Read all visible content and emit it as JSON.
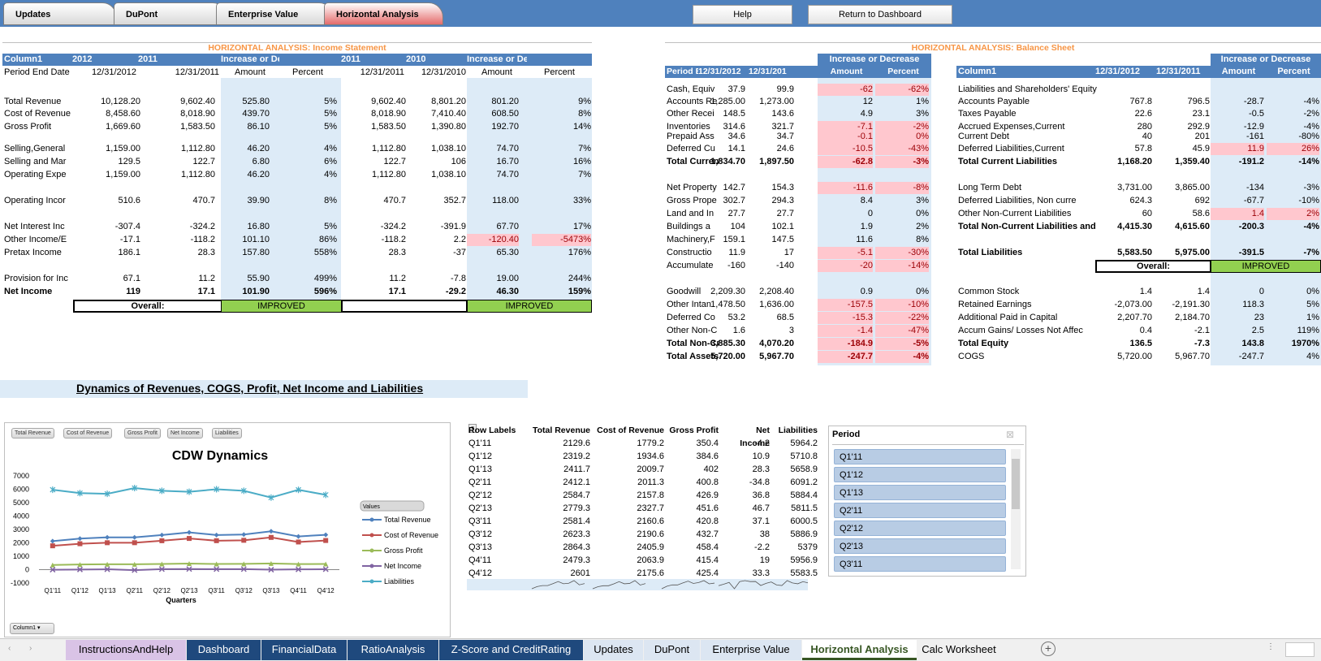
{
  "nav": {
    "tabs": [
      "Updates",
      "DuPont",
      "Enterprise Value",
      "Horizontal Analysis"
    ],
    "help": "Help",
    "return": "Return to Dashboard"
  },
  "is": {
    "title": "HORIZONTAL ANALYSIS: Income Statement",
    "headers": [
      "Column1",
      "2012",
      "2011",
      "Increase or Decrease",
      "",
      "2011",
      "2010",
      "Increase or Decrease",
      ""
    ],
    "sub": [
      "Period End Date",
      "12/31/2012",
      "12/31/2011",
      "Amount",
      "Percent",
      "12/31/2011",
      "12/31/2010",
      "Amount",
      "Percent"
    ],
    "rows": [
      {
        "top": 118,
        "label": "Total Revenue",
        "v": [
          "10,128.20",
          "9,602.40",
          "525.80",
          "5%",
          "9,602.40",
          "8,801.20",
          "801.20",
          "9%"
        ]
      },
      {
        "top": 133,
        "label": "Cost of Revenue",
        "v": [
          "8,458.60",
          "8,018.90",
          "439.70",
          "5%",
          "8,018.90",
          "7,410.40",
          "608.50",
          "8%"
        ]
      },
      {
        "top": 149,
        "label": "Gross Profit",
        "v": [
          "1,669.60",
          "1,583.50",
          "86.10",
          "5%",
          "1,583.50",
          "1,390.80",
          "192.70",
          "14%"
        ]
      },
      {
        "top": 176,
        "label": "Selling,General",
        "v": [
          "1,159.00",
          "1,112.80",
          "46.20",
          "4%",
          "1,112.80",
          "1,038.10",
          "74.70",
          "7%"
        ]
      },
      {
        "top": 192,
        "label": "Selling and Mar",
        "v": [
          "129.5",
          "122.7",
          "6.80",
          "6%",
          "122.7",
          "106",
          "16.70",
          "16%"
        ]
      },
      {
        "top": 208,
        "label": "Operating Expe",
        "v": [
          "1,159.00",
          "1,112.80",
          "46.20",
          "4%",
          "1,112.80",
          "1,038.10",
          "74.70",
          "7%"
        ]
      },
      {
        "top": 240,
        "label": "Operating Incor",
        "v": [
          "510.6",
          "470.7",
          "39.90",
          "8%",
          "470.7",
          "352.7",
          "118.00",
          "33%"
        ]
      },
      {
        "top": 272,
        "label": "Net Interest Inc",
        "v": [
          "-307.4",
          "-324.2",
          "16.80",
          "5%",
          "-324.2",
          "-391.9",
          "67.70",
          "17%"
        ]
      },
      {
        "top": 288,
        "label": "Other Income/E",
        "v": [
          "-17.1",
          "-118.2",
          "101.10",
          "86%",
          "-118.2",
          "2.2",
          "-120.40",
          "-5473%"
        ],
        "negR": true
      },
      {
        "top": 304,
        "label": "Pretax Income",
        "v": [
          "186.1",
          "28.3",
          "157.80",
          "558%",
          "28.3",
          "-37",
          "65.30",
          "176%"
        ]
      },
      {
        "top": 336,
        "label": "Provision for Inc",
        "v": [
          "67.1",
          "11.2",
          "55.90",
          "499%",
          "11.2",
          "-7.8",
          "19.00",
          "244%"
        ]
      },
      {
        "top": 352,
        "label": "Net Income",
        "v": [
          "119",
          "17.1",
          "101.90",
          "596%",
          "17.1",
          "-29.2",
          "46.30",
          "159%"
        ],
        "bold": true
      }
    ],
    "overall": "Overall:",
    "improved1": "IMPROVED",
    "improved2": "IMPROVED"
  },
  "bs": {
    "title": "HORIZONTAL ANALYSIS: Balance Sheet",
    "incdec": "Increase or Decrease",
    "left_headers": [
      "Period End D",
      "12/31/2012",
      "12/31/201",
      "Amount",
      "Percent"
    ],
    "left": [
      {
        "top": 103,
        "label": "Cash, Equiv",
        "v": [
          "37.9",
          "99.9",
          "-62",
          "-62%"
        ],
        "neg": true
      },
      {
        "top": 118,
        "label": "Accounts Re",
        "v": [
          "1,285.00",
          "1,273.00",
          "12",
          "1%"
        ]
      },
      {
        "top": 133,
        "label": "Other Recei",
        "v": [
          "148.5",
          "143.6",
          "4.9",
          "3%"
        ]
      },
      {
        "top": 149,
        "label": "Inventories",
        "v": [
          "314.6",
          "321.7",
          "-7.1",
          "-2%"
        ],
        "neg": true
      },
      {
        "top": 161,
        "label": "Prepaid Ass",
        "v": [
          "34.6",
          "34.7",
          "-0.1",
          "0%"
        ],
        "neg": true
      },
      {
        "top": 176,
        "label": "Deferred Cu",
        "v": [
          "14.1",
          "24.6",
          "-10.5",
          "-43%"
        ],
        "neg": true
      },
      {
        "top": 192,
        "label": "Total Current",
        "v": [
          "1,834.70",
          "1,897.50",
          "-62.8",
          "-3%"
        ],
        "neg": true,
        "bold": true
      },
      {
        "top": 224,
        "label": "Net Property",
        "v": [
          "142.7",
          "154.3",
          "-11.6",
          "-8%"
        ],
        "neg": true
      },
      {
        "top": 240,
        "label": "Gross Prope",
        "v": [
          "302.7",
          "294.3",
          "8.4",
          "3%"
        ]
      },
      {
        "top": 256,
        "label": "Land and In",
        "v": [
          "27.7",
          "27.7",
          "0",
          "0%"
        ]
      },
      {
        "top": 272,
        "label": "Buildings a",
        "v": [
          "104",
          "102.1",
          "1.9",
          "2%"
        ]
      },
      {
        "top": 288,
        "label": "Machinery,F",
        "v": [
          "159.1",
          "147.5",
          "11.6",
          "8%"
        ]
      },
      {
        "top": 304,
        "label": "Constructio",
        "v": [
          "11.9",
          "17",
          "-5.1",
          "-30%"
        ],
        "neg": true
      },
      {
        "top": 320,
        "label": "Accumulate",
        "v": [
          "-160",
          "-140",
          "-20",
          "-14%"
        ],
        "neg": true
      },
      {
        "top": 352,
        "label": "Goodwill",
        "v": [
          "2,209.30",
          "2,208.40",
          "0.9",
          "0%"
        ]
      },
      {
        "top": 368,
        "label": "Other Intan",
        "v": [
          "1,478.50",
          "1,636.00",
          "-157.5",
          "-10%"
        ],
        "neg": true
      },
      {
        "top": 384,
        "label": "Deferred Co",
        "v": [
          "53.2",
          "68.5",
          "-15.3",
          "-22%"
        ],
        "neg": true
      },
      {
        "top": 400,
        "label": "Other Non-C",
        "v": [
          "1.6",
          "3",
          "-1.4",
          "-47%"
        ],
        "neg": true
      },
      {
        "top": 416,
        "label": "Total Non-Cu",
        "v": [
          "3,885.30",
          "4,070.20",
          "-184.9",
          "-5%"
        ],
        "neg": true,
        "bold": true
      },
      {
        "top": 432,
        "label": "Total Assets",
        "v": [
          "5,720.00",
          "5,967.70",
          "-247.7",
          "-4%"
        ],
        "neg": true,
        "bold": true
      }
    ],
    "right_headers": [
      "Column1",
      "12/31/2012",
      "12/31/2011",
      "Amount",
      "Percent"
    ],
    "right_sub": "Liabilities and Shareholders' Equity",
    "right": [
      {
        "top": 118,
        "label": "Accounts Payable",
        "v": [
          "767.8",
          "796.5",
          "-28.7",
          "-4%"
        ]
      },
      {
        "top": 133,
        "label": "Taxes Payable",
        "v": [
          "22.6",
          "23.1",
          "-0.5",
          "-2%"
        ]
      },
      {
        "top": 149,
        "label": "Accrued Expenses,Current",
        "v": [
          "280",
          "292.9",
          "-12.9",
          "-4%"
        ]
      },
      {
        "top": 161,
        "label": "Current Debt",
        "v": [
          "40",
          "201",
          "-161",
          "-80%"
        ]
      },
      {
        "top": 176,
        "label": "Deferred Liabilities,Current",
        "v": [
          "57.8",
          "45.9",
          "11.9",
          "26%"
        ],
        "neg": true
      },
      {
        "top": 192,
        "label": "Total Current Liabilities",
        "v": [
          "1,168.20",
          "1,359.40",
          "-191.2",
          "-14%"
        ],
        "bold": true
      },
      {
        "top": 224,
        "label": "Long Term Debt",
        "v": [
          "3,731.00",
          "3,865.00",
          "-134",
          "-3%"
        ]
      },
      {
        "top": 240,
        "label": "Deferred Liabilities, Non curre",
        "v": [
          "624.3",
          "692",
          "-67.7",
          "-10%"
        ]
      },
      {
        "top": 256,
        "label": "Other Non-Current Liabilities",
        "v": [
          "60",
          "58.6",
          "1.4",
          "2%"
        ],
        "neg": true
      },
      {
        "top": 272,
        "label": "Total Non-Current Liabilities and M",
        "v": [
          "4,415.30",
          "4,615.60",
          "-200.3",
          "-4%"
        ],
        "bold": true
      },
      {
        "top": 304,
        "label": "Total Liabilities",
        "v": [
          "5,583.50",
          "5,975.00",
          "-391.5",
          "-7%"
        ],
        "bold": true
      },
      {
        "top": 352,
        "label": "Common Stock",
        "v": [
          "1.4",
          "1.4",
          "0",
          "0%"
        ]
      },
      {
        "top": 368,
        "label": "Retained Earnings",
        "v": [
          "-2,073.00",
          "-2,191.30",
          "118.3",
          "5%"
        ]
      },
      {
        "top": 384,
        "label": "Additional Paid in Capital",
        "v": [
          "2,207.70",
          "2,184.70",
          "23",
          "1%"
        ]
      },
      {
        "top": 400,
        "label": "Accum Gains/ Losses Not Affec",
        "v": [
          "0.4",
          "-2.1",
          "2.5",
          "119%"
        ]
      },
      {
        "top": 416,
        "label": "Total Equity",
        "v": [
          "136.5",
          "-7.3",
          "143.8",
          "1970%"
        ],
        "bold": true
      },
      {
        "top": 432,
        "label": "COGS",
        "v": [
          "5,720.00",
          "5,967.70",
          "-247.7",
          "4%"
        ]
      }
    ],
    "overall": "Overall:",
    "improved": "IMPROVED"
  },
  "dyn_title": "Dynamics of Revenues, COGS, Profit, Net Income and Liabilities",
  "chart_filters": [
    "Total Revenue",
    "Cost of Revenue",
    "Gross Profit",
    "Net Income",
    "Liabilities"
  ],
  "chart_data": {
    "type": "line",
    "title": "CDW Dynamics",
    "xlabel": "Quarters",
    "ylabel": "",
    "categories": [
      "Q1'11",
      "Q1'12",
      "Q1'13",
      "Q2'11",
      "Q2'12",
      "Q2'13",
      "Q3'11",
      "Q3'12",
      "Q3'13",
      "Q4'11",
      "Q4'12"
    ],
    "ylim": [
      -1000,
      7000
    ],
    "yticks": [
      7000,
      6000,
      5000,
      4000,
      3000,
      2000,
      1000,
      0,
      -1000
    ],
    "legend_title": "Values",
    "series": [
      {
        "name": "Total Revenue",
        "color": "#4f81bd",
        "marker": "diamond",
        "values": [
          2129.6,
          2319.2,
          2411.7,
          2412.1,
          2584.7,
          2779.3,
          2581.4,
          2623.3,
          2864.3,
          2479.3,
          2601
        ]
      },
      {
        "name": "Cost of Revenue",
        "color": "#c0504d",
        "marker": "square",
        "values": [
          1779.2,
          1934.6,
          2009.7,
          2011.3,
          2157.8,
          2327.7,
          2160.6,
          2190.6,
          2405.9,
          2063.9,
          2175.6
        ]
      },
      {
        "name": "Gross Profit",
        "color": "#9bbb59",
        "marker": "triangle",
        "values": [
          350.4,
          384.6,
          402,
          400.8,
          426.9,
          451.6,
          420.8,
          432.7,
          458.4,
          415.4,
          425.4
        ]
      },
      {
        "name": "Net Income",
        "color": "#8064a2",
        "marker": "x",
        "values": [
          -4.2,
          10.9,
          28.3,
          -34.8,
          36.8,
          46.7,
          37.1,
          38,
          -2.2,
          19,
          33.3
        ]
      },
      {
        "name": "Liabilities",
        "color": "#4bacc6",
        "marker": "star",
        "values": [
          5964.2,
          5710.8,
          5658.9,
          6091.2,
          5884.4,
          5811.5,
          6000.5,
          5886.9,
          5379,
          5956.9,
          5583.5
        ]
      }
    ]
  },
  "column1_btn": "Column1",
  "pivot": {
    "headers": [
      "Row Labels",
      "Total Revenue",
      "Cost of Revenue",
      "Gross Profit",
      "Net Income",
      "Liabilities"
    ],
    "rows": [
      [
        "Q1'11",
        "2129.6",
        "1779.2",
        "350.4",
        "-4.2",
        "5964.2"
      ],
      [
        "Q1'12",
        "2319.2",
        "1934.6",
        "384.6",
        "10.9",
        "5710.8"
      ],
      [
        "Q1'13",
        "2411.7",
        "2009.7",
        "402",
        "28.3",
        "5658.9"
      ],
      [
        "Q2'11",
        "2412.1",
        "2011.3",
        "400.8",
        "-34.8",
        "6091.2"
      ],
      [
        "Q2'12",
        "2584.7",
        "2157.8",
        "426.9",
        "36.8",
        "5884.4"
      ],
      [
        "Q2'13",
        "2779.3",
        "2327.7",
        "451.6",
        "46.7",
        "5811.5"
      ],
      [
        "Q3'11",
        "2581.4",
        "2160.6",
        "420.8",
        "37.1",
        "6000.5"
      ],
      [
        "Q3'12",
        "2623.3",
        "2190.6",
        "432.7",
        "38",
        "5886.9"
      ],
      [
        "Q3'13",
        "2864.3",
        "2405.9",
        "458.4",
        "-2.2",
        "5379"
      ],
      [
        "Q4'11",
        "2479.3",
        "2063.9",
        "415.4",
        "19",
        "5956.9"
      ],
      [
        "Q4'12",
        "2601",
        "2175.6",
        "425.4",
        "33.3",
        "5583.5"
      ]
    ]
  },
  "slicer": {
    "title": "Period",
    "items": [
      "Q1'11",
      "Q1'12",
      "Q1'13",
      "Q2'11",
      "Q2'12",
      "Q2'13",
      "Q3'11"
    ]
  },
  "sheets": [
    "InstructionsAndHelp",
    "Dashboard",
    "FinancialData",
    "RatioAnalysis",
    "Z-Score and CreditRating",
    "Updates",
    "DuPont",
    "Enterprise Value",
    "Horizontal Analysis",
    "Calc Worksheet"
  ]
}
